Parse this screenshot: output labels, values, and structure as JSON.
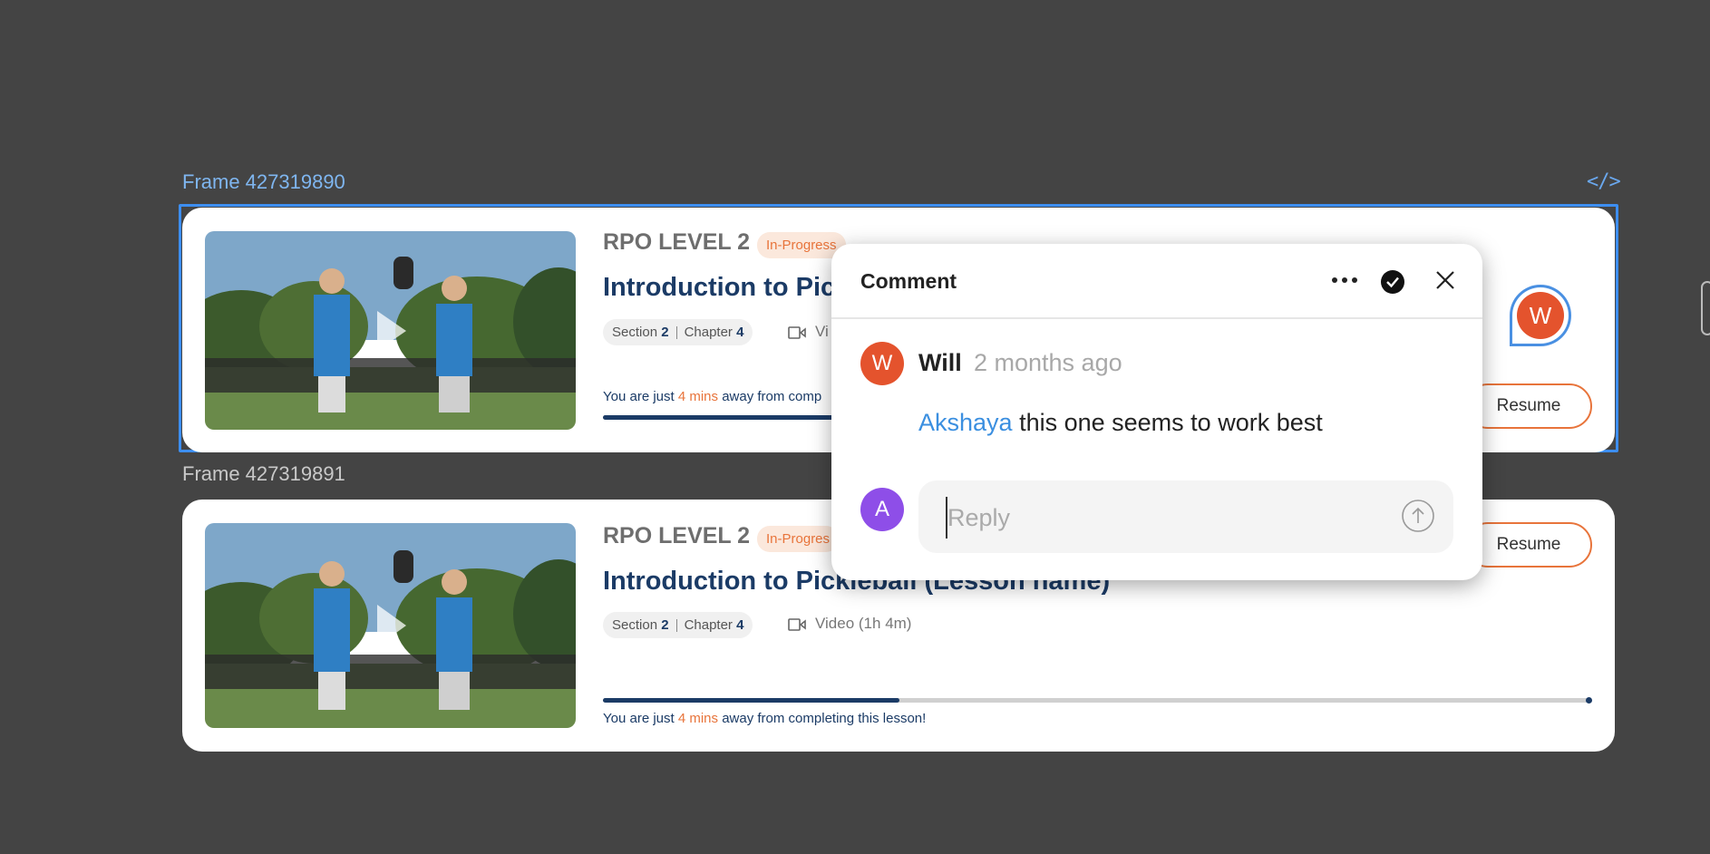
{
  "frames": [
    {
      "label": "Frame 427319890"
    },
    {
      "label": "Frame 427319891"
    }
  ],
  "code_icon": "</>",
  "cards": [
    {
      "level": "RPO LEVEL 2",
      "badge": "In-Progress",
      "title": "Introduction to Pic",
      "chip_section_label": "Section",
      "chip_section_num": "2",
      "chip_chapter_label": "Chapter",
      "chip_chapter_num": "4",
      "video_label": "Vi",
      "away_prefix": "You are just",
      "away_mins": "4 mins",
      "away_suffix": "away from comp",
      "resume_label": "Resume",
      "progress_percent": 30
    },
    {
      "level": "RPO LEVEL 2",
      "badge": "In-Progres",
      "title": "Introduction to Pickleball (Lesson name)",
      "chip_section_label": "Section",
      "chip_section_num": "2",
      "chip_chapter_label": "Chapter",
      "chip_chapter_num": "4",
      "video_label": "Video (1h 4m)",
      "away_prefix": "You are just",
      "away_mins": "4 mins",
      "away_suffix": "away from completing this lesson!",
      "resume_label": "Resume",
      "progress_percent": 30
    }
  ],
  "comment": {
    "title": "Comment",
    "author_initial": "W",
    "author": "Will",
    "time": "2 months ago",
    "mention": "Akshaya",
    "body": "this one seems to work best",
    "reply_initial": "A",
    "reply_placeholder": "Reply",
    "pin_initial": "W"
  },
  "colors": {
    "accent_blue": "#3d8ef0",
    "navy": "#1b3b66",
    "orange": "#e8743b",
    "avatar_will": "#e4532d",
    "avatar_a": "#8e4ee8"
  },
  "icons": [
    "code-icon",
    "play-icon",
    "video-icon",
    "more-icon",
    "resolve-check-icon",
    "close-icon",
    "send-icon"
  ]
}
